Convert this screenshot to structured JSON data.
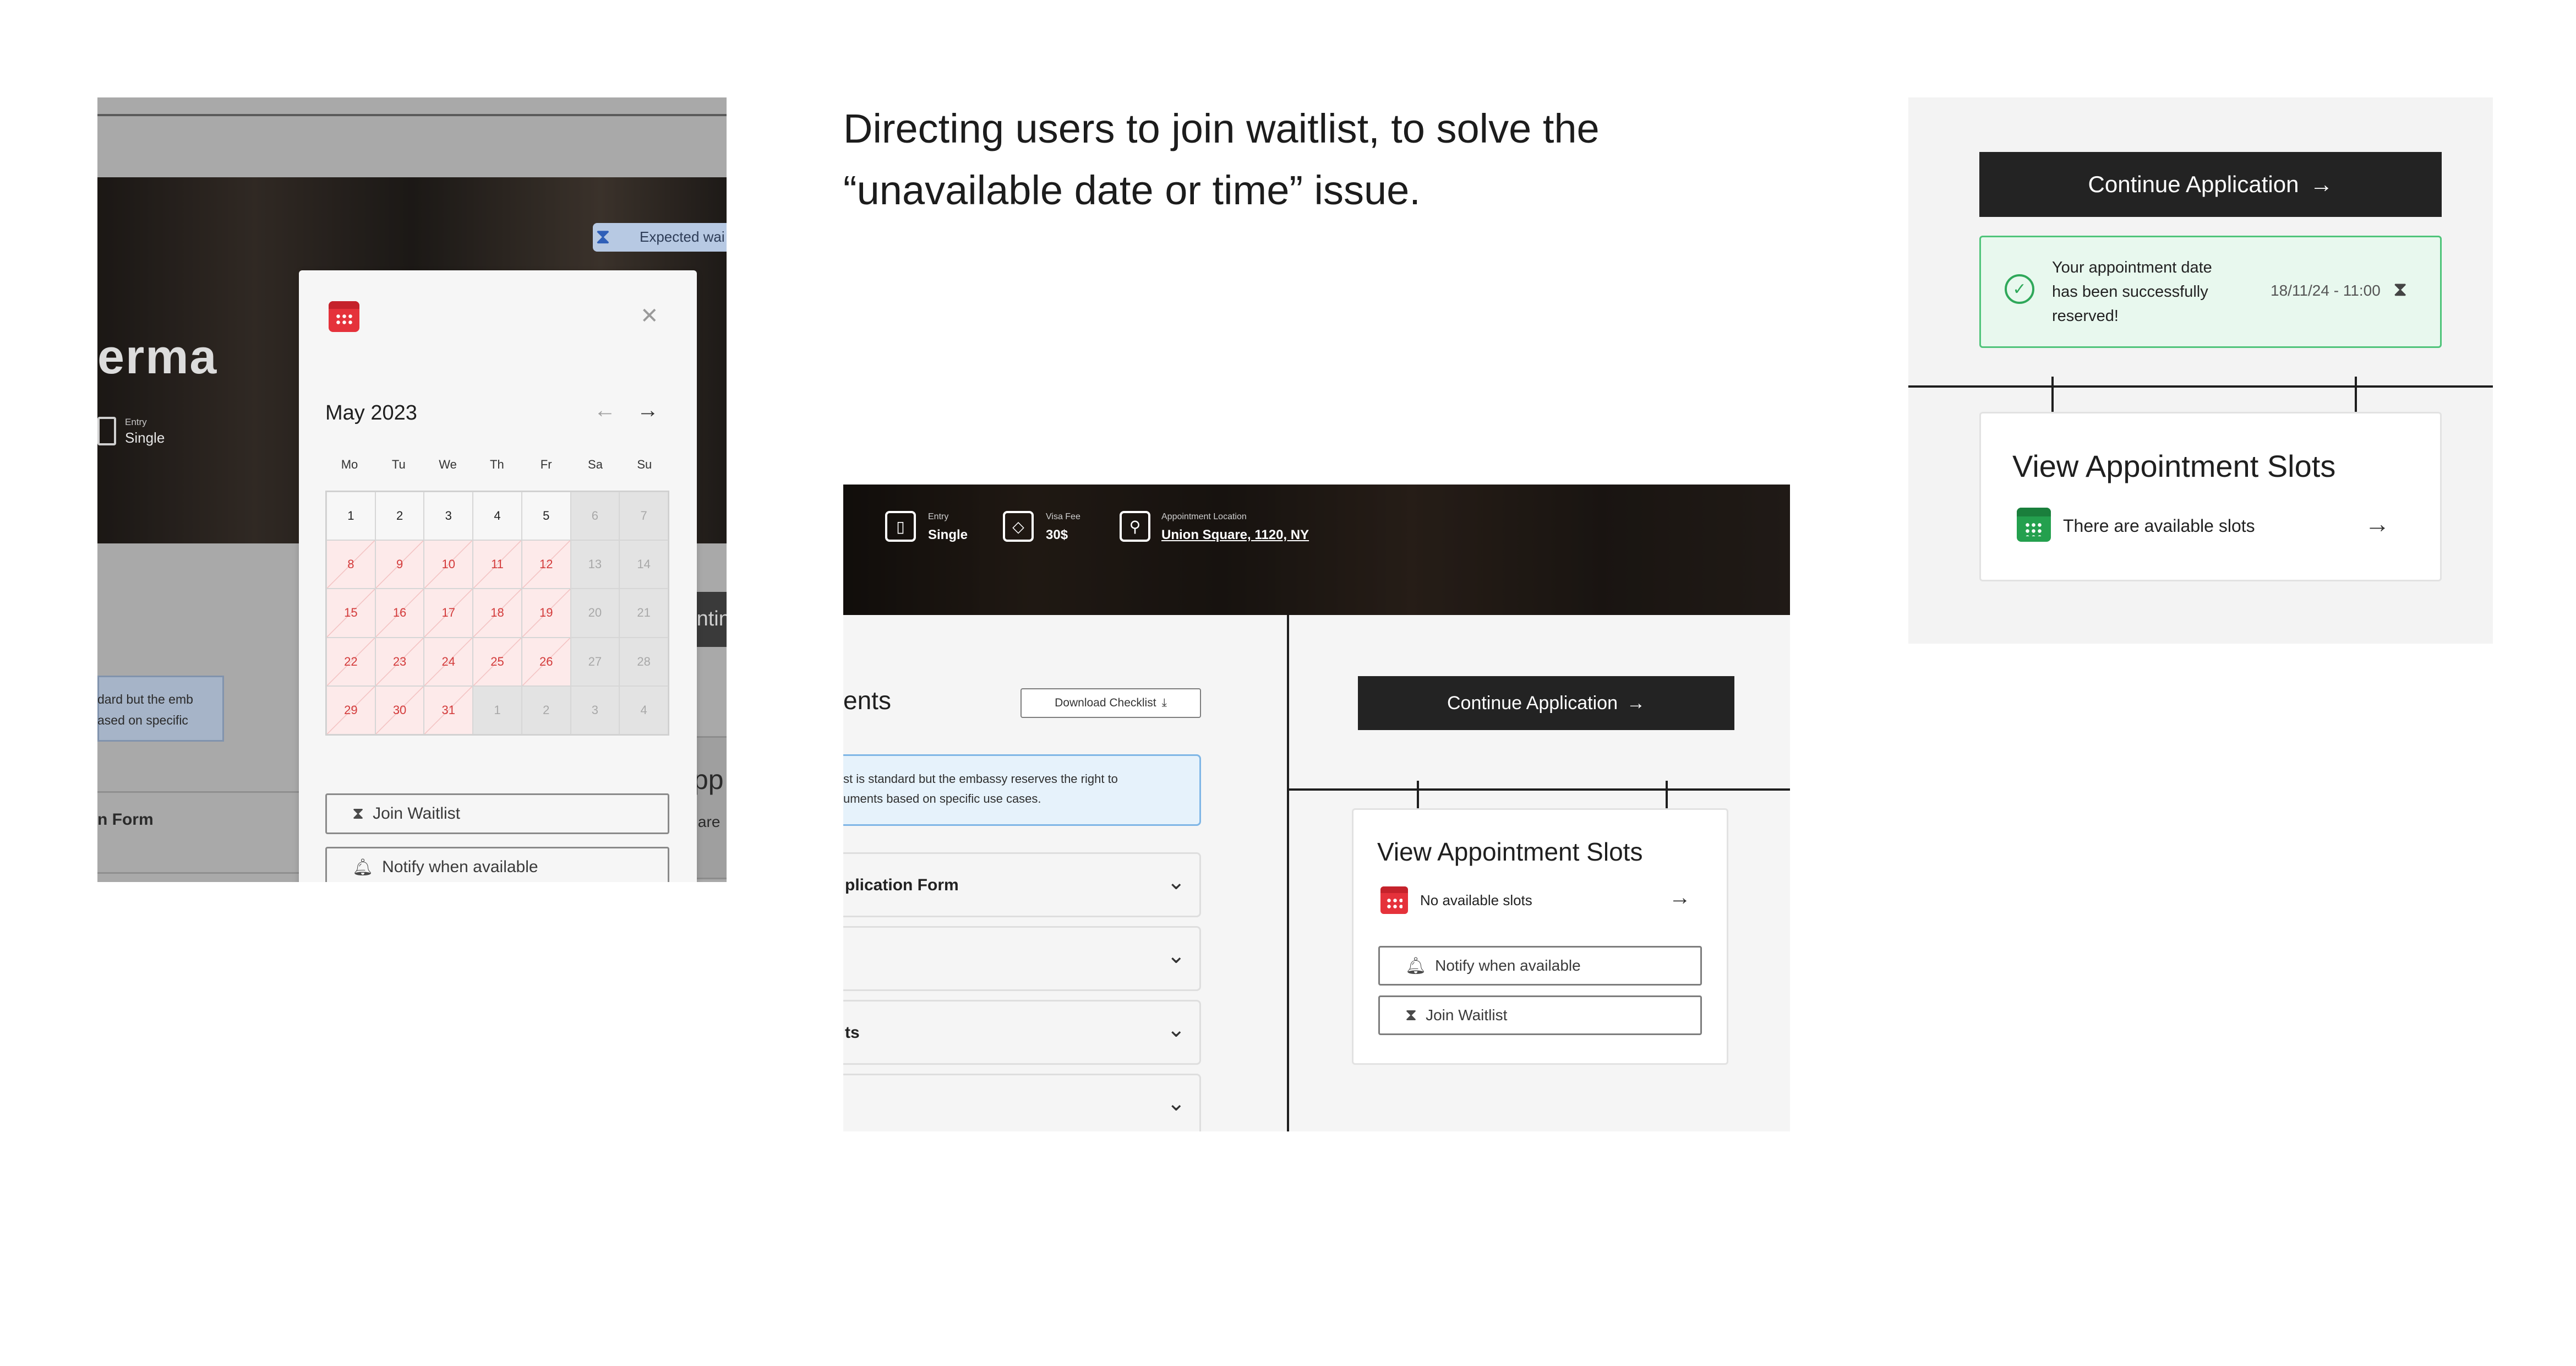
{
  "headline": "Directing users to join waitlist, to solve the “unavailable date or time” issue.",
  "left_mockup": {
    "hero_partial": "erma",
    "entry_label": "Entry",
    "entry_value": "Single",
    "expected_partial": "Expected wai",
    "continue_partial": "Contin",
    "view_partial": "View App",
    "there_are_partial": "There are",
    "note_line1": "dard but the emb",
    "note_line2": "ased on specific",
    "form_partial": "n Form",
    "calendar": {
      "month": "May 2023",
      "weekdays": [
        "Mo",
        "Tu",
        "We",
        "Th",
        "Fr",
        "Sa",
        "Su"
      ],
      "days": [
        {
          "d": "1",
          "s": "normal"
        },
        {
          "d": "2",
          "s": "normal"
        },
        {
          "d": "3",
          "s": "normal"
        },
        {
          "d": "4",
          "s": "normal"
        },
        {
          "d": "5",
          "s": "normal"
        },
        {
          "d": "6",
          "s": "grey"
        },
        {
          "d": "7",
          "s": "grey"
        },
        {
          "d": "8",
          "s": "red"
        },
        {
          "d": "9",
          "s": "red"
        },
        {
          "d": "10",
          "s": "red"
        },
        {
          "d": "11",
          "s": "red"
        },
        {
          "d": "12",
          "s": "red"
        },
        {
          "d": "13",
          "s": "grey"
        },
        {
          "d": "14",
          "s": "grey"
        },
        {
          "d": "15",
          "s": "red"
        },
        {
          "d": "16",
          "s": "red"
        },
        {
          "d": "17",
          "s": "red"
        },
        {
          "d": "18",
          "s": "red"
        },
        {
          "d": "19",
          "s": "red"
        },
        {
          "d": "20",
          "s": "grey"
        },
        {
          "d": "21",
          "s": "grey"
        },
        {
          "d": "22",
          "s": "red"
        },
        {
          "d": "23",
          "s": "red"
        },
        {
          "d": "24",
          "s": "red"
        },
        {
          "d": "25",
          "s": "red"
        },
        {
          "d": "26",
          "s": "red"
        },
        {
          "d": "27",
          "s": "grey"
        },
        {
          "d": "28",
          "s": "grey"
        },
        {
          "d": "29",
          "s": "red"
        },
        {
          "d": "30",
          "s": "red"
        },
        {
          "d": "31",
          "s": "red"
        },
        {
          "d": "1",
          "s": "grey"
        },
        {
          "d": "2",
          "s": "grey"
        },
        {
          "d": "3",
          "s": "grey"
        },
        {
          "d": "4",
          "s": "grey"
        }
      ],
      "join_waitlist": "Join Waitlist",
      "notify_available": "Notify when available"
    }
  },
  "middle_mockup": {
    "header": {
      "entry_label": "Entry",
      "entry_value": "Single",
      "fee_label": "Visa Fee",
      "fee_value": "30$",
      "location_label": "Appointment Location",
      "location_value": "Union Square, 1120, NY"
    },
    "section_partial": "ents",
    "download_checklist": "Download Checklist",
    "info_line1": "st is standard but the embassy reserves the right to",
    "info_line2": "uments based on specific use cases.",
    "accordions": [
      "plication Form",
      "",
      "ts",
      ""
    ],
    "continue_application": "Continue Application",
    "slots_title": "View Appointment Slots",
    "no_slots": "No available slots",
    "notify_available": "Notify when available",
    "join_waitlist": "Join Waitlist"
  },
  "right_mockup": {
    "continue_application": "Continue Application",
    "success_message": "Your appointment date has been successfully reserved!",
    "reserved_datetime": "18/11/24 - 11:00",
    "slots_title": "View Appointment Slots",
    "available_slots": "There are available slots"
  },
  "colors": {
    "accent_dark": "#232323",
    "unavailable_red": "#e5323b",
    "available_green": "#24a04e",
    "success_bg": "#e8f8ee",
    "info_blue": "#7fb6e6"
  }
}
